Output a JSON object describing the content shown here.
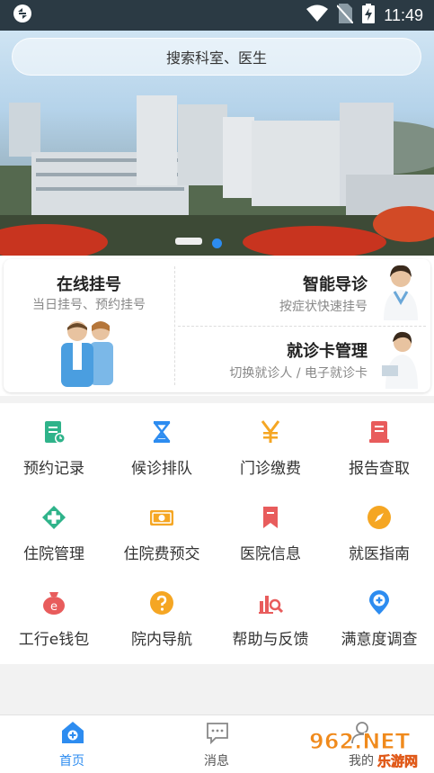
{
  "status_bar": {
    "time": "11:49"
  },
  "search": {
    "placeholder": "搜索科室、医生"
  },
  "banner": {
    "slide_count": 3,
    "active_index": 0
  },
  "services": {
    "online": {
      "title": "在线挂号",
      "subtitle": "当日挂号、预约挂号"
    },
    "smart": {
      "title": "智能导诊",
      "subtitle": "按症状快速挂号"
    },
    "card": {
      "title": "就诊卡管理",
      "subtitle": "切换就诊人 / 电子就诊卡"
    }
  },
  "grid": [
    {
      "label": "预约记录",
      "icon": "calendar-record-icon",
      "color": "#2fb38a"
    },
    {
      "label": "候诊排队",
      "icon": "hourglass-icon",
      "color": "#2d8cf0"
    },
    {
      "label": "门诊缴费",
      "icon": "yen-icon",
      "color": "#f5a623"
    },
    {
      "label": "报告查取",
      "icon": "report-icon",
      "color": "#e85c5c"
    },
    {
      "label": "住院管理",
      "icon": "medical-cross-icon",
      "color": "#2fb38a"
    },
    {
      "label": "住院费预交",
      "icon": "money-icon",
      "color": "#f5a623"
    },
    {
      "label": "医院信息",
      "icon": "bookmark-icon",
      "color": "#e85c5c"
    },
    {
      "label": "就医指南",
      "icon": "compass-icon",
      "color": "#f5a623"
    },
    {
      "label": "工行e钱包",
      "icon": "wallet-e-icon",
      "color": "#e85c5c"
    },
    {
      "label": "院内导航",
      "icon": "question-icon",
      "color": "#f5a623"
    },
    {
      "label": "帮助与反馈",
      "icon": "chart-search-icon",
      "color": "#e85c5c"
    },
    {
      "label": "满意度调查",
      "icon": "location-plus-icon",
      "color": "#2d8cf0"
    }
  ],
  "tabs": [
    {
      "label": "首页",
      "active": true
    },
    {
      "label": "消息",
      "active": false
    },
    {
      "label": "我的",
      "active": false
    }
  ],
  "watermark": {
    "text_top": "962.NET",
    "text_bottom": "乐游网"
  },
  "colors": {
    "accent": "#2d8cf0",
    "status_bar": "#2b3a44"
  }
}
